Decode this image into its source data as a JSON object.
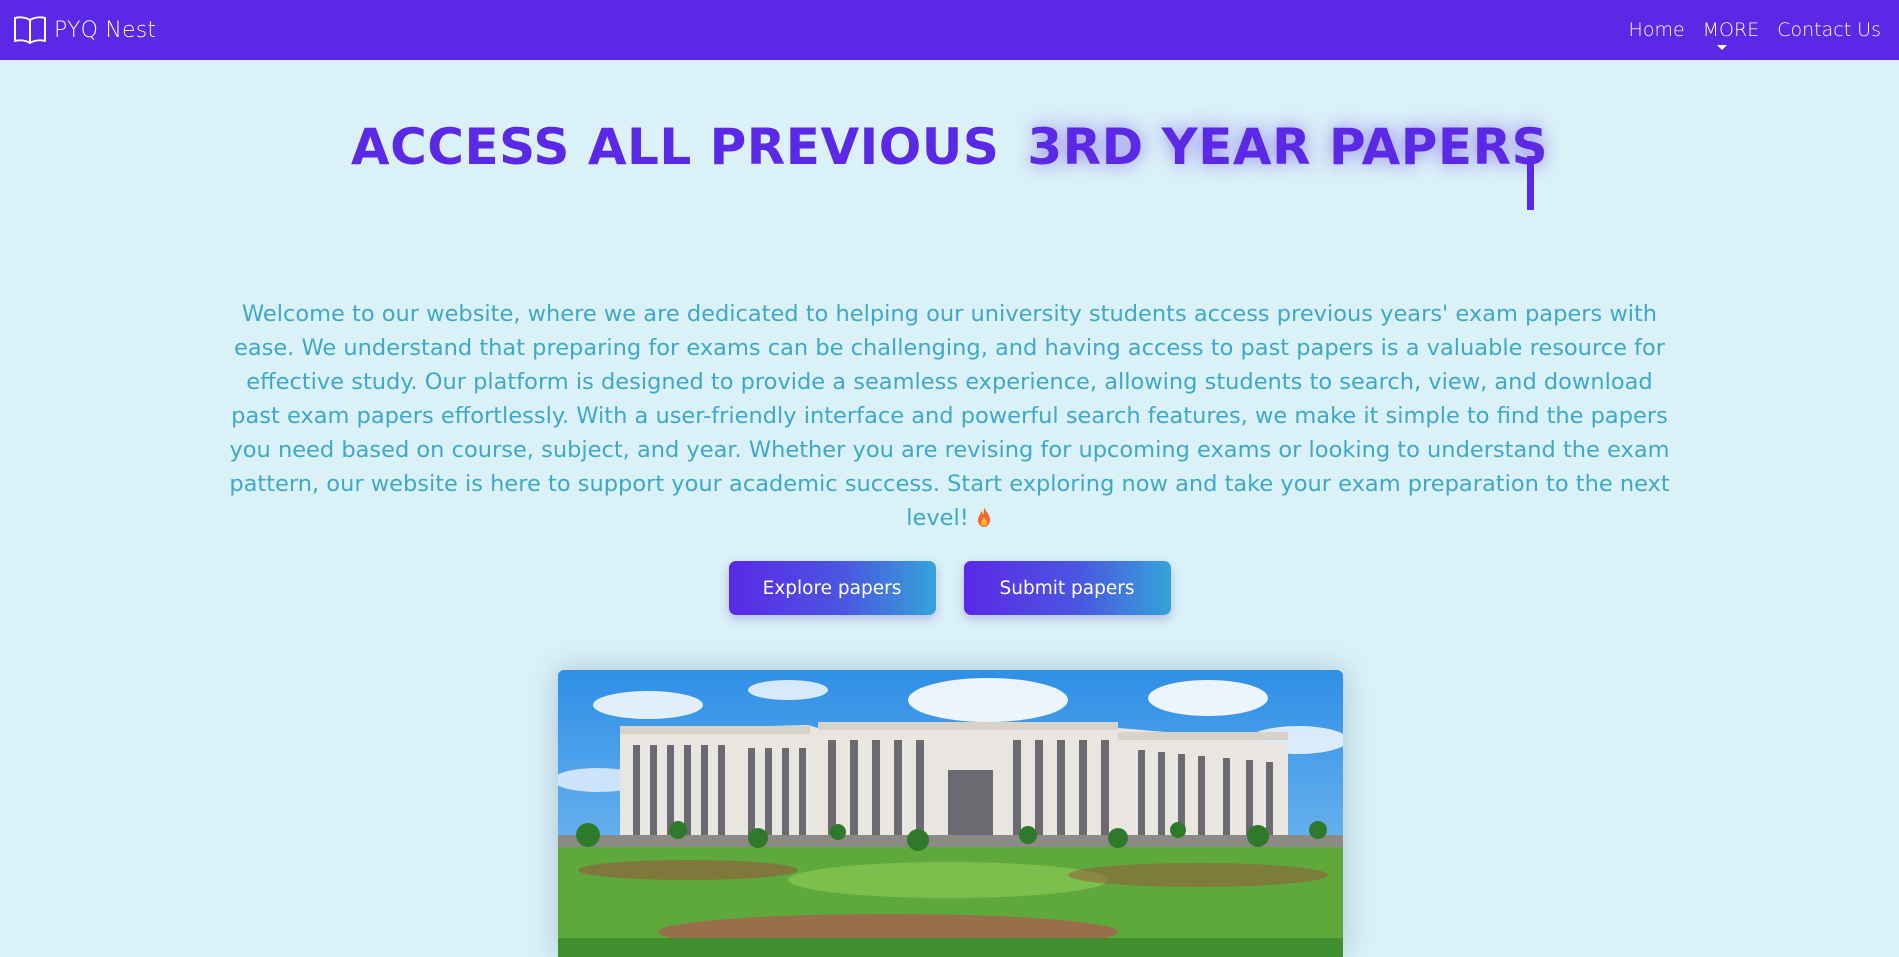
{
  "nav": {
    "brand": "PYQ Nest",
    "links": {
      "home": "Home",
      "more": "MORE",
      "contact": "Contact Us"
    }
  },
  "hero": {
    "headline_static": "ACCESS ALL PREVIOUS",
    "headline_typed": "3RD YEAR PAPERS",
    "intro": "Welcome to our website, where we are dedicated to helping our university students access previous years' exam papers with ease. We understand that preparing for exams can be challenging, and having access to past papers is a valuable resource for effective study. Our platform is designed to provide a seamless experience, allowing students to search, view, and download past exam papers effortlessly. With a user-friendly interface and powerful search features, we make it simple to find the papers you need based on course, subject, and year. Whether you are revising for upcoming exams or looking to understand the exam pattern, our website is here to support your academic success. Start exploring now and take your exam preparation to the next level!",
    "buttons": {
      "explore": "Explore papers",
      "submit": "Submit papers"
    }
  },
  "colors": {
    "nav_bg": "#5b28e6",
    "page_bg": "#daf1f8",
    "accent": "#5b28e6",
    "intro_text": "#3fa8c8"
  },
  "icons": {
    "brand": "open-book-icon",
    "intro_end": "fire-icon",
    "more_dropdown": "caret-down-icon"
  }
}
